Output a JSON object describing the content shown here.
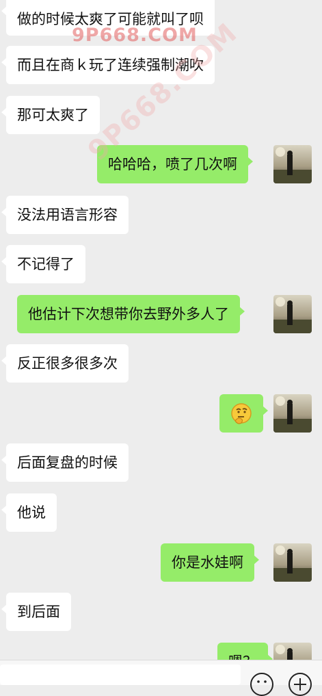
{
  "watermark": {
    "main": "9P668.COM",
    "diagonal": "9P668.COM"
  },
  "messages": [
    {
      "side": "in",
      "text": "做的时候太爽了可能就叫了呗"
    },
    {
      "side": "in",
      "text": "而且在商ｋ玩了连续强制潮吹"
    },
    {
      "side": "in",
      "text": "那可太爽了"
    },
    {
      "side": "out",
      "text": "哈哈哈，喷了几次啊",
      "avatar": "avatar-photo"
    },
    {
      "side": "in",
      "text": "没法用语言形容"
    },
    {
      "side": "in",
      "text": "不记得了"
    },
    {
      "side": "out",
      "text": "他估计下次想带你去野外多人了",
      "avatar": "avatar-photo"
    },
    {
      "side": "in",
      "text": "反正很多很多次"
    },
    {
      "side": "out",
      "text": "",
      "emoji": "thinking-face-emoji",
      "avatar": "avatar-photo"
    },
    {
      "side": "in",
      "text": "后面复盘的时候"
    },
    {
      "side": "in",
      "text": "他说"
    },
    {
      "side": "out",
      "text": "你是水娃啊",
      "avatar": "avatar-photo"
    },
    {
      "side": "in",
      "text": "到后面"
    },
    {
      "side": "out",
      "text": "嗯？",
      "avatar": "avatar-photo"
    }
  ],
  "input_bar": {
    "icons": [
      "emoji-icon",
      "plus-icon"
    ]
  },
  "colors": {
    "background": "#ededed",
    "incoming": "#ffffff",
    "outgoing": "#95ec69"
  }
}
